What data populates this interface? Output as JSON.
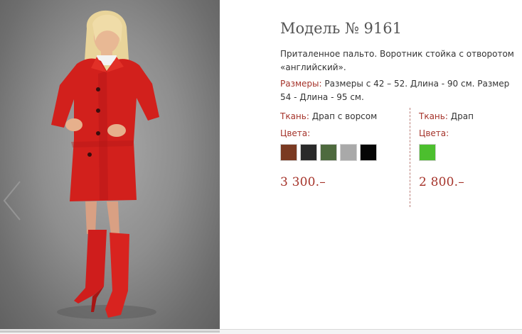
{
  "product": {
    "title": "Модель № 9161",
    "description": "Приталенное пальто. Воротник стойка с отворотом «английский».",
    "sizes_label": "Размеры:",
    "sizes_text": "Размеры с 42 – 52. Длина - 90 см. Размер 54 - Длина - 95 см."
  },
  "variants": [
    {
      "fabric_label": "Ткань:",
      "fabric_value": "Драп с ворсом",
      "colors_label": "Цвета:",
      "swatches": [
        "#7a3a22",
        "#2a2a2a",
        "#4e6a3e",
        "#a9a9a9",
        "#060606"
      ],
      "price": "3 300.–"
    },
    {
      "fabric_label": "Ткань:",
      "fabric_value": "Драп",
      "colors_label": "Цвета:",
      "swatches": [
        "#4cbf2e"
      ],
      "price": "2 800.–"
    }
  ],
  "gallery": {
    "prev_icon": "chevron-left-icon"
  },
  "colors": {
    "accent": "#a5332a",
    "coat": "#d2201c"
  }
}
